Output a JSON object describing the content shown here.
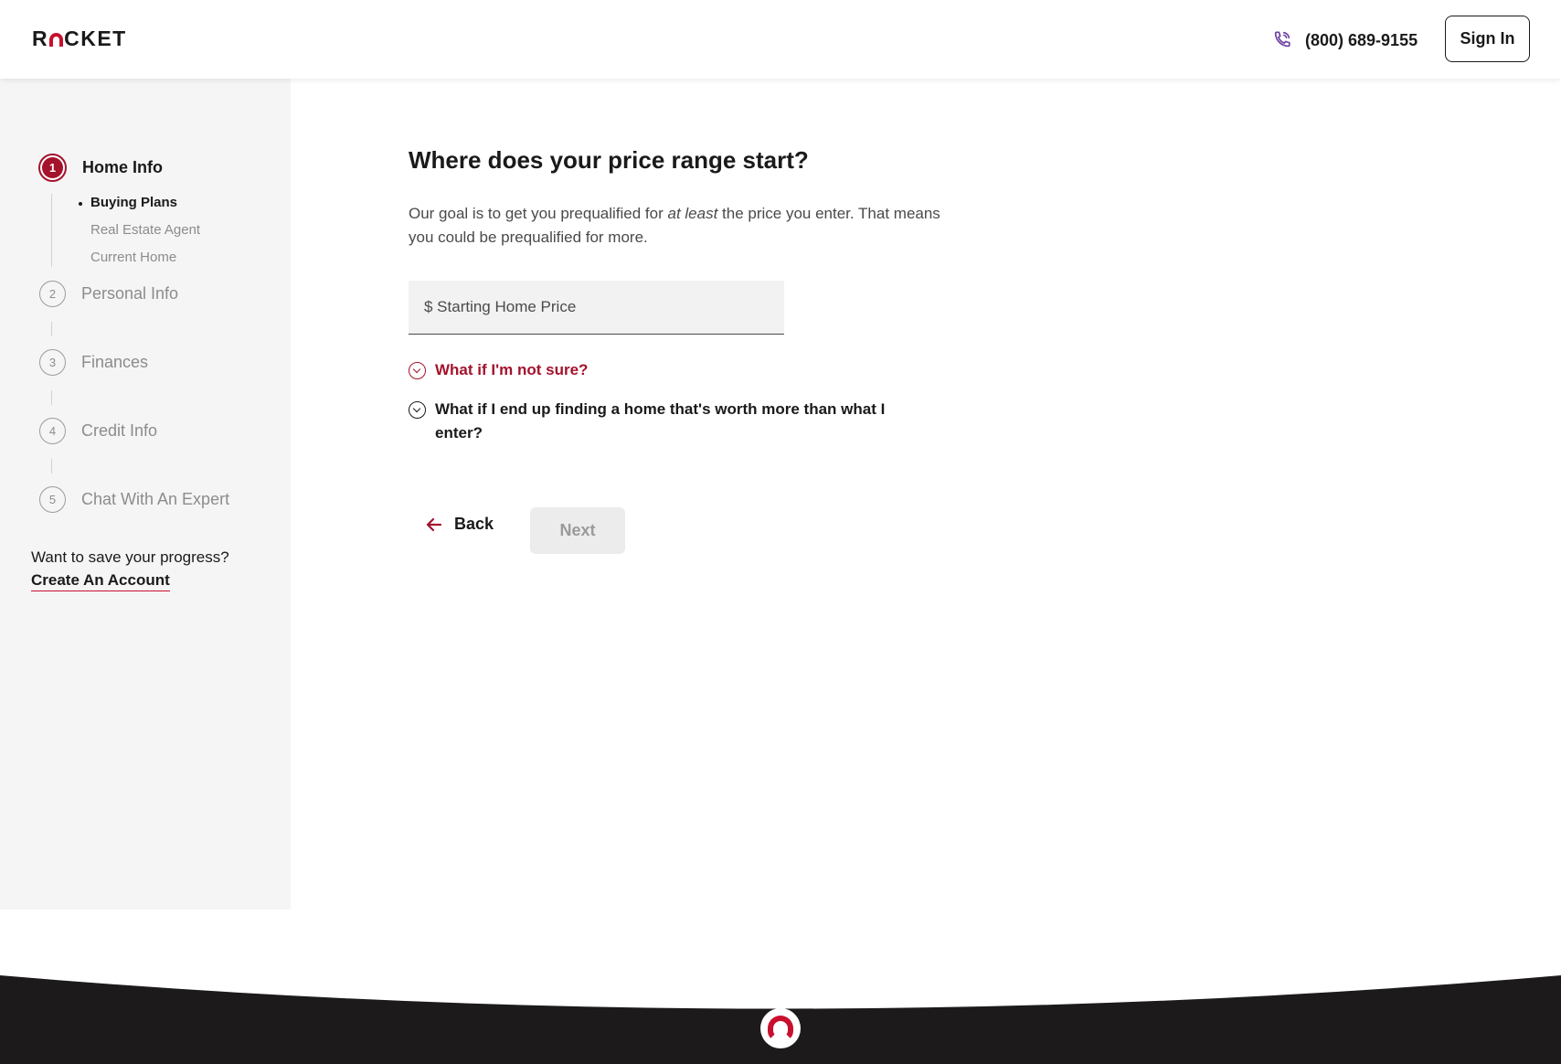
{
  "header": {
    "logo_text_left": "R",
    "logo_text_right": "CKET",
    "phone": "(800) 689-9155",
    "sign_in": "Sign In"
  },
  "sidebar": {
    "steps": [
      {
        "number": "1",
        "label": "Home Info",
        "state": "active"
      },
      {
        "number": "2",
        "label": "Personal Info",
        "state": "upcoming"
      },
      {
        "number": "3",
        "label": "Finances",
        "state": "upcoming"
      },
      {
        "number": "4",
        "label": "Credit Info",
        "state": "upcoming"
      },
      {
        "number": "5",
        "label": "Chat With An Expert",
        "state": "upcoming"
      }
    ],
    "substeps": [
      {
        "label": "Buying Plans",
        "state": "current"
      },
      {
        "label": "Real Estate Agent",
        "state": "upcoming"
      },
      {
        "label": "Current Home",
        "state": "upcoming"
      }
    ],
    "save_prompt": "Want to save your progress?",
    "create_account": "Create An Account"
  },
  "main": {
    "title": "Where does your price range start?",
    "desc_before": "Our goal is to get you prequalified for ",
    "desc_emphasis": "at least",
    "desc_after": " the price you enter. That means you could be prequalified for more.",
    "price_placeholder": "$ Starting Home Price",
    "faq": [
      "What if I'm not sure?",
      "What if I end up finding a home that's worth more than what I enter?"
    ],
    "back": "Back",
    "next": "Next"
  },
  "colors": {
    "brand_red": "#c8102e",
    "active_red": "#a4122b",
    "phone_icon": "#6b3fa0",
    "sidebar_bg": "#f5f5f5",
    "footer_bg": "#1c1a1a"
  }
}
